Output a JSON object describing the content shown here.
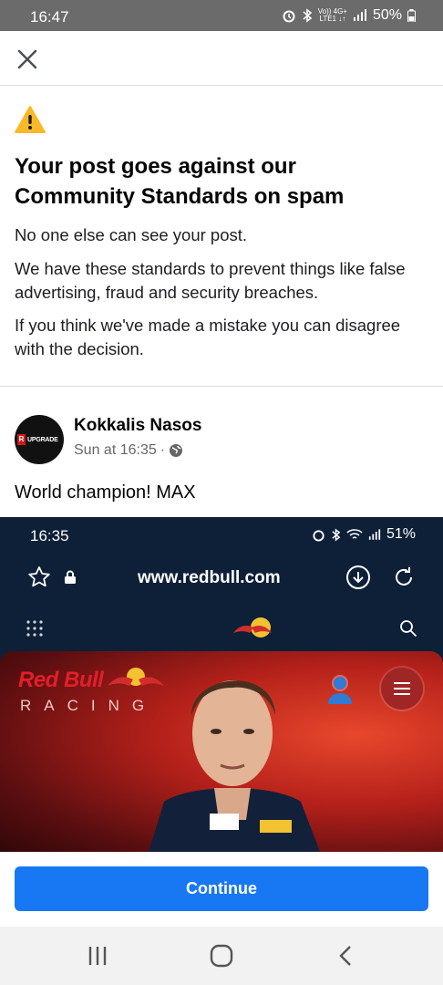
{
  "status_bar": {
    "time": "16:47",
    "network_top": "Vo)) 4G+",
    "network_bottom": "LTE1 ↓↑",
    "battery": "50%"
  },
  "notice": {
    "title": "Your post goes against our Community Standards on spam",
    "line1": "No one else can see your post.",
    "line2": "We have these standards to prevent things like false advertising, fraud and security breaches.",
    "line3": "If you think we've made a mistake you can disagree with the decision."
  },
  "post": {
    "avatar_letter": "R",
    "avatar_text": "UPGRADE",
    "author": "Kokkalis Nasos",
    "timestamp": "Sun at 16:35",
    "separator": "·",
    "text": "World champion!  MAX"
  },
  "screenshot": {
    "time": "16:35",
    "battery": "51%",
    "url": "www.redbull.com",
    "brand": "Red Bull",
    "subtitle": "RACING"
  },
  "continue_label": "Continue",
  "colors": {
    "primary": "#1877f2",
    "warning": "#f7b928",
    "status_bar": "#6b6b6b"
  },
  "icons": [
    "close-icon",
    "warning-icon",
    "globe-icon",
    "star-icon",
    "lock-icon",
    "download-icon",
    "refresh-icon",
    "grid-icon",
    "search-icon",
    "recents-icon",
    "home-icon",
    "back-icon"
  ]
}
